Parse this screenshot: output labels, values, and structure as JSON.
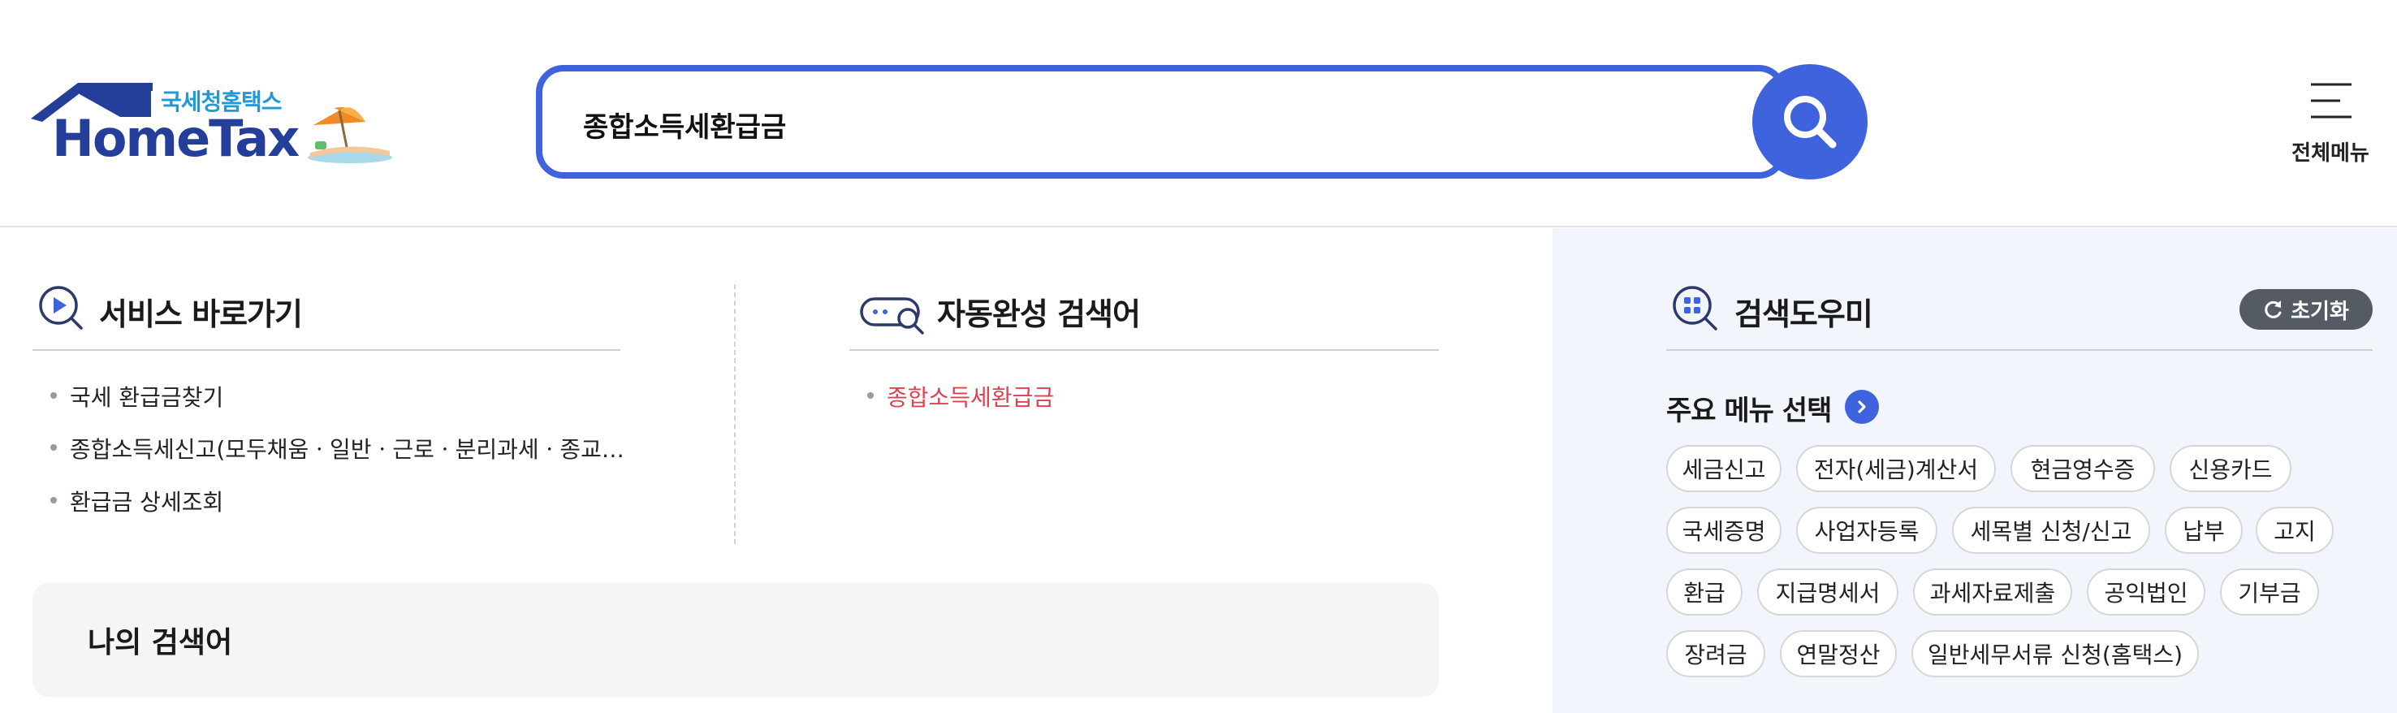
{
  "header": {
    "logo_sub": "국세청홈택스",
    "logo_main": "HomeTax",
    "search_value": "종합소득세환급금",
    "all_menu_label": "전체메뉴"
  },
  "service_shortcut": {
    "title": "서비스 바로가기",
    "items": [
      "국세 환급금찾기",
      "종합소득세신고(모두채움ㆍ일반ㆍ근로ㆍ분리과세ㆍ종교…",
      "환급금 상세조회"
    ]
  },
  "autocomplete": {
    "title": "자동완성 검색어",
    "items": [
      "종합소득세환급금"
    ]
  },
  "my_search": {
    "title": "나의 검색어"
  },
  "search_helper": {
    "title": "검색도우미",
    "reset_label": "초기화",
    "menu_select_title": "주요 메뉴 선택",
    "chips": [
      [
        "세금신고",
        "전자(세금)계산서",
        "현금영수증",
        "신용카드"
      ],
      [
        "국세증명",
        "사업자등록",
        "세목별 신청/신고",
        "납부",
        "고지"
      ],
      [
        "환급",
        "지급명세서",
        "과세자료제출",
        "공익법인",
        "기부금"
      ],
      [
        "장려금",
        "연말정산",
        "일반세무서류 신청(홈택스)"
      ]
    ]
  },
  "colors": {
    "brand_blue": "#3e63dd",
    "logo_navy": "#243f99",
    "logo_cyan": "#1f9ad6",
    "highlight_red": "#e2404f",
    "helper_bg": "#f2f5fb"
  }
}
